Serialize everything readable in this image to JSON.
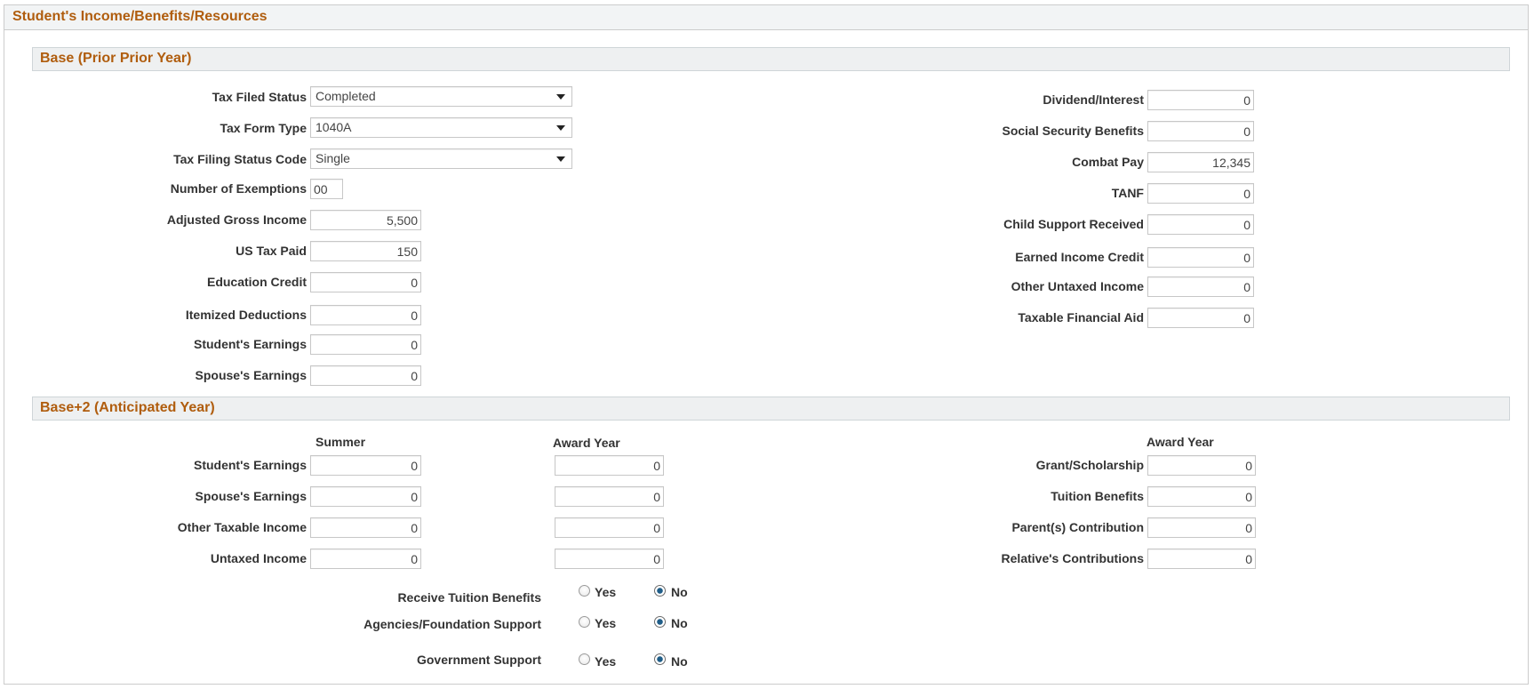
{
  "page": {
    "title": "Student's Income/Benefits/Resources"
  },
  "base": {
    "title": "Base (Prior Prior Year)",
    "tax_filed_status": {
      "label": "Tax Filed Status",
      "value": "Completed"
    },
    "tax_form_type": {
      "label": "Tax Form Type",
      "value": "1040A"
    },
    "tax_filing_status_code": {
      "label": "Tax Filing Status Code",
      "value": "Single"
    },
    "number_of_exemptions": {
      "label": "Number of Exemptions",
      "value": "00"
    },
    "adjusted_gross_income": {
      "label": "Adjusted Gross Income",
      "value": "5,500"
    },
    "us_tax_paid": {
      "label": "US Tax Paid",
      "value": "150"
    },
    "education_credit": {
      "label": "Education Credit",
      "value": "0"
    },
    "itemized_deductions": {
      "label": "Itemized Deductions",
      "value": "0"
    },
    "students_earnings": {
      "label": "Student's Earnings",
      "value": "0"
    },
    "spouses_earnings": {
      "label": "Spouse's Earnings",
      "value": "0"
    },
    "dividend_interest": {
      "label": "Dividend/Interest",
      "value": "0"
    },
    "social_security_benefits": {
      "label": "Social Security Benefits",
      "value": "0"
    },
    "combat_pay": {
      "label": "Combat Pay",
      "value": "12,345"
    },
    "tanf": {
      "label": "TANF",
      "value": "0"
    },
    "child_support_received": {
      "label": "Child Support Received",
      "value": "0"
    },
    "earned_income_credit": {
      "label": "Earned Income Credit",
      "value": "0"
    },
    "other_untaxed_income": {
      "label": "Other Untaxed Income",
      "value": "0"
    },
    "taxable_financial_aid": {
      "label": "Taxable Financial Aid",
      "value": "0"
    }
  },
  "anticipated": {
    "title": "Base+2 (Anticipated Year)",
    "col_summer": "Summer",
    "col_award_year": "Award Year",
    "col_award_year_right": "Award Year",
    "students_earnings": {
      "label": "Student's Earnings",
      "summer": "0",
      "award": "0"
    },
    "spouses_earnings": {
      "label": "Spouse's Earnings",
      "summer": "0",
      "award": "0"
    },
    "other_taxable_income": {
      "label": "Other Taxable Income",
      "summer": "0",
      "award": "0"
    },
    "untaxed_income": {
      "label": "Untaxed Income",
      "summer": "0",
      "award": "0"
    },
    "grant_scholarship": {
      "label": "Grant/Scholarship",
      "value": "0"
    },
    "tuition_benefits": {
      "label": "Tuition Benefits",
      "value": "0"
    },
    "parents_contribution": {
      "label": "Parent(s) Contribution",
      "value": "0"
    },
    "relatives_contributions": {
      "label": "Relative's Contributions",
      "value": "0"
    },
    "receive_tuition_benefits": {
      "label": "Receive Tuition Benefits",
      "yes": "Yes",
      "no": "No",
      "selected": "No"
    },
    "agencies_foundation_support": {
      "label": "Agencies/Foundation Support",
      "yes": "Yes",
      "no": "No",
      "selected": "No"
    },
    "government_support": {
      "label": "Government Support",
      "yes": "Yes",
      "no": "No",
      "selected": "No"
    }
  },
  "colors": {
    "heading": "#b05d0e",
    "section_bg": "#eef0f1",
    "border": "#cccccc",
    "radio_selected": "#1f5d88"
  },
  "icons": {
    "dropdown": "chevron-down-icon"
  }
}
